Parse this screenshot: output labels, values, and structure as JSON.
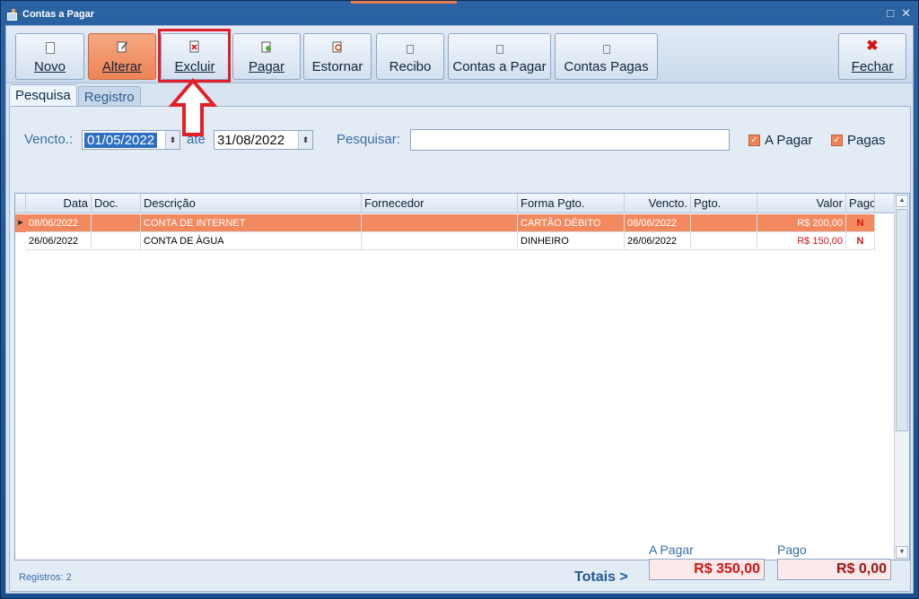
{
  "window": {
    "title": "Contas a Pagar",
    "controls": [
      "□",
      "✕"
    ]
  },
  "toolbar": {
    "novo": "Novo",
    "alterar": "Alterar",
    "excluir": "Excluir",
    "pagar": "Pagar",
    "estornar": "Estornar",
    "recibo": "Recibo",
    "contas_a_pagar": "Contas a Pagar",
    "contas_pagas": "Contas Pagas",
    "fechar": "Fechar"
  },
  "tabs": {
    "pesquisa": "Pesquisa",
    "registro": "Registro"
  },
  "filter": {
    "vencto_label": "Vencto.:",
    "date_from": "01/05/2022",
    "ate_label": "até",
    "date_to": "31/08/2022",
    "pesquisar_label": "Pesquisar:",
    "search_value": "",
    "a_pagar_label": "A Pagar",
    "pagas_label": "Pagas"
  },
  "grid": {
    "columns": [
      "Data",
      "Doc.",
      "Descrição",
      "Fornecedor",
      "Forma Pgto.",
      "Vencto.",
      "Pgto.",
      "Valor",
      "Pago"
    ],
    "rows": [
      {
        "data": "08/06/2022",
        "doc": "",
        "descricao": "CONTA DE INTERNET",
        "fornecedor": "",
        "forma": "CARTÃO DÉBITO",
        "vencto": "08/06/2022",
        "pgto": "",
        "valor": "R$ 200,00",
        "pago": "N"
      },
      {
        "data": "26/06/2022",
        "doc": "",
        "descricao": "CONTA DE ÀGUA",
        "fornecedor": "",
        "forma": "DINHEIRO",
        "vencto": "26/06/2022",
        "pgto": "",
        "valor": "R$ 150,00",
        "pago": "N"
      }
    ]
  },
  "footer": {
    "registros": "Registros: 2",
    "totais_label": "Totais >",
    "a_pagar_label": "A Pagar",
    "a_pagar_value": "R$ 350,00",
    "pago_label": "Pago",
    "pago_value": "R$ 0,00"
  },
  "colors": {
    "accent": "#ee8356",
    "highlight": "#e3202a",
    "selection": "#f2895f",
    "value_red": "#d11616"
  }
}
